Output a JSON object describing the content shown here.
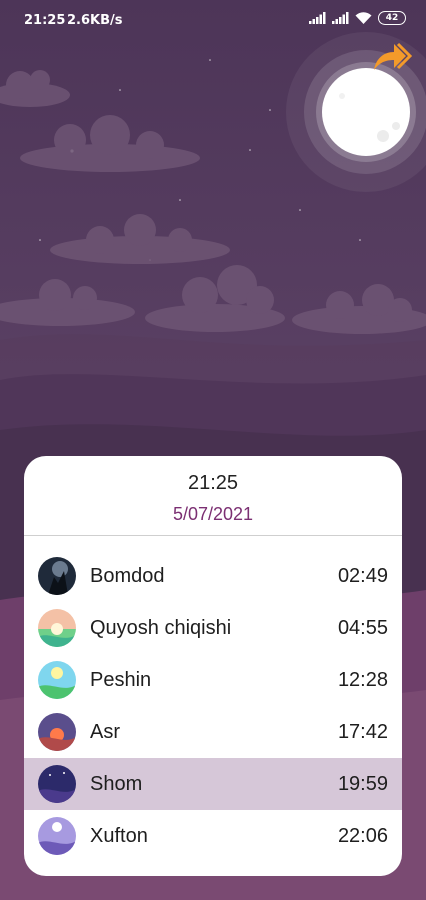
{
  "status_bar": {
    "time": "21:25",
    "speed": "2.6KB/s",
    "battery": "42"
  },
  "card": {
    "time": "21:25",
    "date": "5/07/2021"
  },
  "prayers": [
    {
      "name": "Bomdod",
      "time": "02:49",
      "icon": "night-tree-icon"
    },
    {
      "name": "Quyosh chiqishi",
      "time": "04:55",
      "icon": "sunrise-icon"
    },
    {
      "name": "Peshin",
      "time": "12:28",
      "icon": "noon-sun-icon"
    },
    {
      "name": "Asr",
      "time": "17:42",
      "icon": "afternoon-sunset-icon"
    },
    {
      "name": "Shom",
      "time": "19:59",
      "icon": "dusk-icon"
    },
    {
      "name": "Xufton",
      "time": "22:06",
      "icon": "night-moon-icon"
    }
  ],
  "active_prayer": "Shom",
  "colors": {
    "background": "#5a3f63",
    "date_accent": "#7b2f72",
    "active_row": "#d6c7d8",
    "share_accent": "#f39a2a"
  }
}
